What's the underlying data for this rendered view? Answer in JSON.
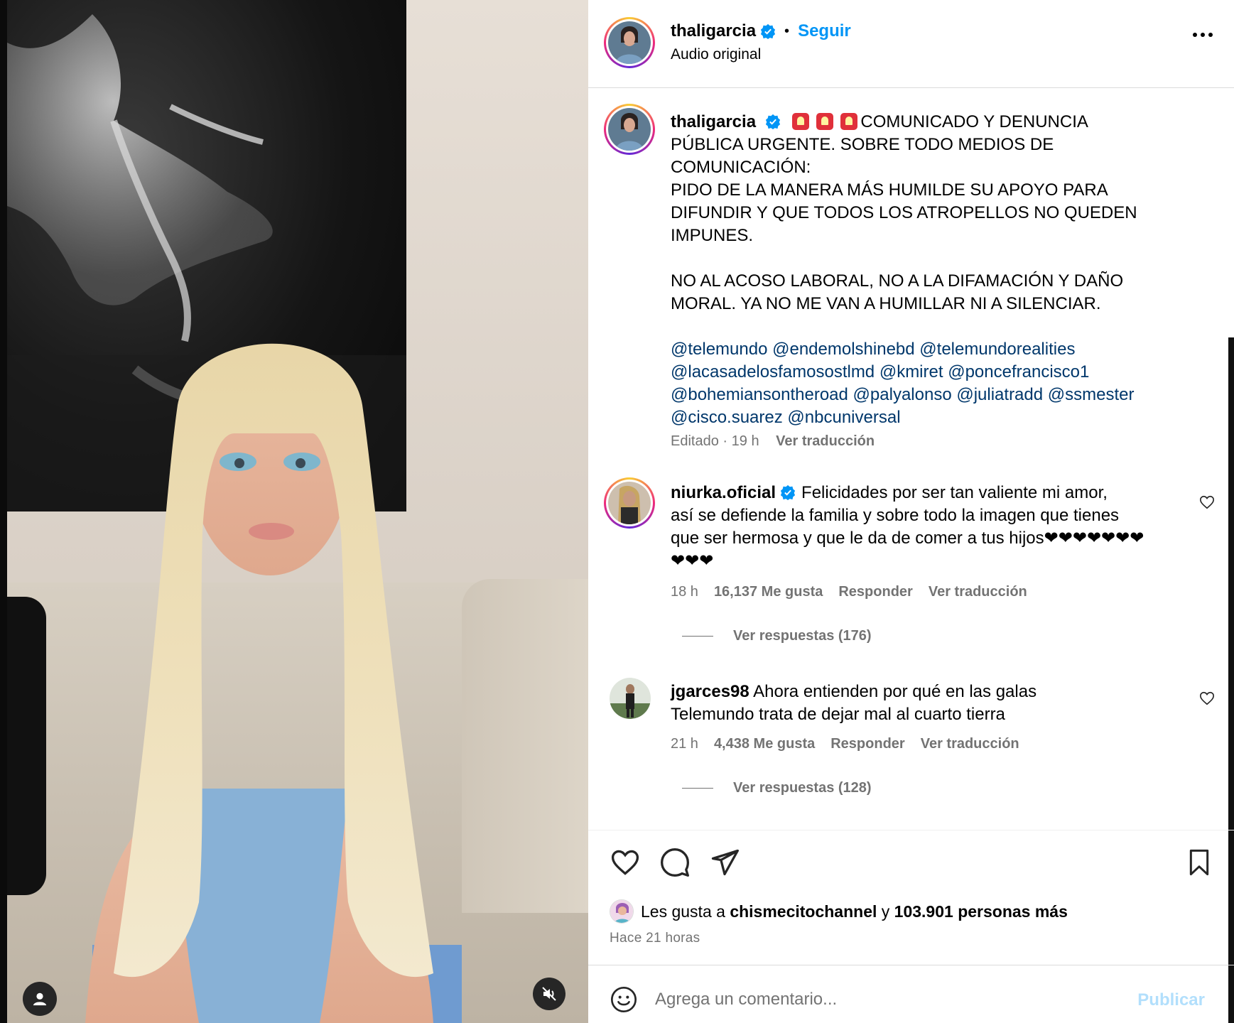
{
  "header": {
    "username": "thaligarcia",
    "separator": "•",
    "follow_label": "Seguir",
    "audio_label": "Audio original"
  },
  "caption": {
    "username": "thaligarcia",
    "lines": [
      "COMUNICADO Y DENUNCIA",
      "PÚBLICA URGENTE. SOBRE TODO MEDIOS DE",
      "COMUNICACIÓN:",
      "PIDO DE LA MANERA MÁS HUMILDE SU APOYO PARA",
      "DIFUNDIR Y QUE TODOS LOS ATROPELLOS NO QUEDEN",
      "IMPUNES.",
      "NO AL ACOSO LABORAL, NO A LA DIFAMACIÓN Y DAÑO",
      "MORAL. YA NO ME VAN A HUMILLAR NI A SILENCIAR."
    ],
    "mentions": [
      [
        "@telemundo",
        "@endemolshinebd",
        "@telemundorealities"
      ],
      [
        "@lacasadelosfamosostlmd",
        "@kmiret",
        "@poncefrancisco1"
      ],
      [
        "@bohemiansontheroad",
        "@palyalonso",
        "@juliatradd",
        "@ssmester"
      ],
      [
        "@cisco.suarez",
        "@nbcuniversal"
      ]
    ],
    "edited_label": "Editado",
    "meta_separator": "·",
    "time": "19 h",
    "translate_label": "Ver traducción"
  },
  "comments": [
    {
      "username": "niurka.oficial",
      "lines": [
        "Felicidades por ser tan valiente mi amor,",
        "así se defiende la familia y sobre todo la imagen que tienes",
        "que ser hermosa y que le da de comer a tus hijos❤❤❤❤❤❤❤",
        "❤❤❤"
      ],
      "time": "18 h",
      "likes": "16,137 Me gusta",
      "reply_label": "Responder",
      "translate_label": "Ver traducción",
      "replies_label": "Ver respuestas (176)"
    },
    {
      "username": "jgarces98",
      "lines": [
        "Ahora entienden por qué en las galas",
        "Telemundo trata de dejar mal al cuarto tierra"
      ],
      "time": "21 h",
      "likes": "4,438 Me gusta",
      "reply_label": "Responder",
      "translate_label": "Ver traducción",
      "replies_label": "Ver respuestas (128)"
    }
  ],
  "likes": {
    "prefix": "Les gusta a",
    "user": "chismecitochannel",
    "connector": "y",
    "others": "103.901 personas más"
  },
  "time_ago": "Hace 21 horas",
  "add_comment": {
    "placeholder": "Agrega un comentario...",
    "publish_label": "Publicar"
  },
  "colors": {
    "link_blue": "#0095f6",
    "mention_blue": "#00376b",
    "muted_text": "#737373",
    "publish_disabled": "#b2dffc",
    "verified_blue": "#0095f6"
  },
  "icons": [
    "user-icon",
    "mute-icon",
    "verified-icon",
    "more-icon",
    "heart-icon",
    "comment-icon",
    "share-icon",
    "bookmark-icon",
    "emoji-icon"
  ]
}
